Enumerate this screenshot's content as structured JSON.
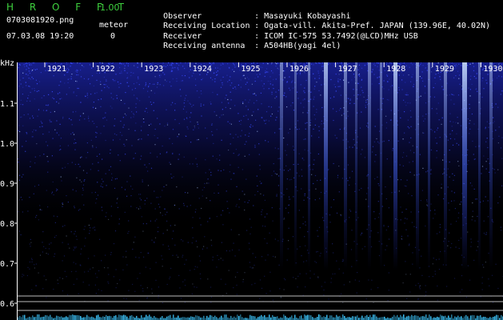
{
  "app": {
    "title": "H R O F F T",
    "version": "1.00"
  },
  "file": {
    "name": "0703081920.png",
    "datetime": "07.03.08 19:20"
  },
  "meteor": {
    "label": "meteor",
    "count": "0"
  },
  "info": [
    {
      "label": "Observer",
      "value": "Masayuki Kobayashi"
    },
    {
      "label": "Receiving Location",
      "value": "Ogata-vill. Akita-Pref. JAPAN (139.96E, 40.02N)"
    },
    {
      "label": "Receiver",
      "value": "ICOM IC-575 53.7492(@LCD)MHz USB"
    },
    {
      "label": "Receiving antenna",
      "value": "A504HB(yagi 4el)"
    }
  ],
  "spectrogram": {
    "unit": "kHz",
    "time_ticks": [
      "1921",
      "1922",
      "1923",
      "1924",
      "1925",
      "1926",
      "1927",
      "1928",
      "1929",
      "1930"
    ],
    "freq_ticks": [
      "1.1",
      "1.0",
      "0.9",
      "0.8",
      "0.7",
      "0.6"
    ],
    "colors": {
      "background": "#000000",
      "signal": "#3344ff",
      "highlight": "#cfe4ff",
      "trace": "#3ec8ff"
    }
  }
}
